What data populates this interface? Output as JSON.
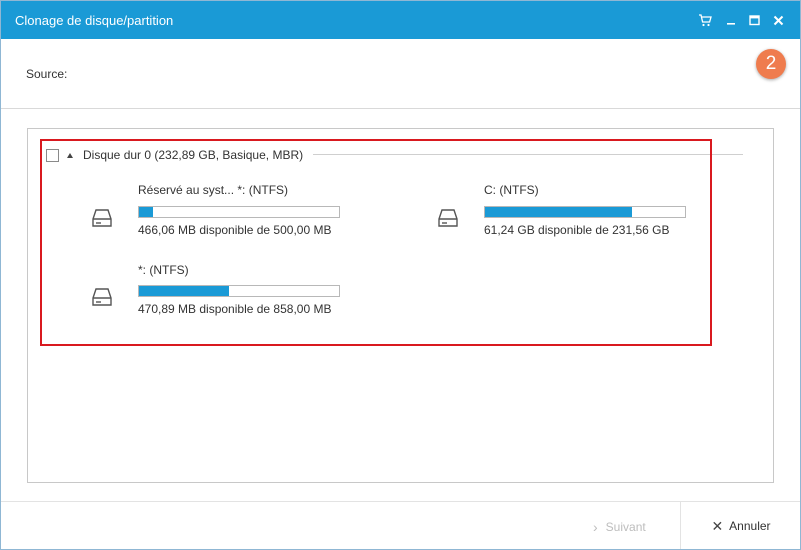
{
  "window": {
    "title": "Clonage de disque/partition"
  },
  "titlebar_icons": [
    "cart-icon",
    "minimize-icon",
    "maximize-icon",
    "close-icon"
  ],
  "source": {
    "label": "Source:",
    "step_number": "2"
  },
  "disk": {
    "label": "Disque dur 0 (232,89 GB, Basique, MBR)",
    "checked": false,
    "expanded": true
  },
  "partitions": [
    {
      "name": "Réservé au syst... *: (NTFS)",
      "info": "466,06 MB disponible de 500,00 MB",
      "used_fraction": 0.068
    },
    {
      "name": "C: (NTFS)",
      "info": "61,24 GB disponible de 231,56 GB",
      "used_fraction": 0.735
    },
    {
      "name": "*: (NTFS)",
      "info": "470,89 MB disponible de 858,00 MB",
      "used_fraction": 0.451
    }
  ],
  "footer": {
    "next_label": "Suivant",
    "cancel_label": "Annuler"
  },
  "colors": {
    "accent": "#1a9ad6",
    "highlight": "#d9191f",
    "badge": "#ef7c4e"
  }
}
